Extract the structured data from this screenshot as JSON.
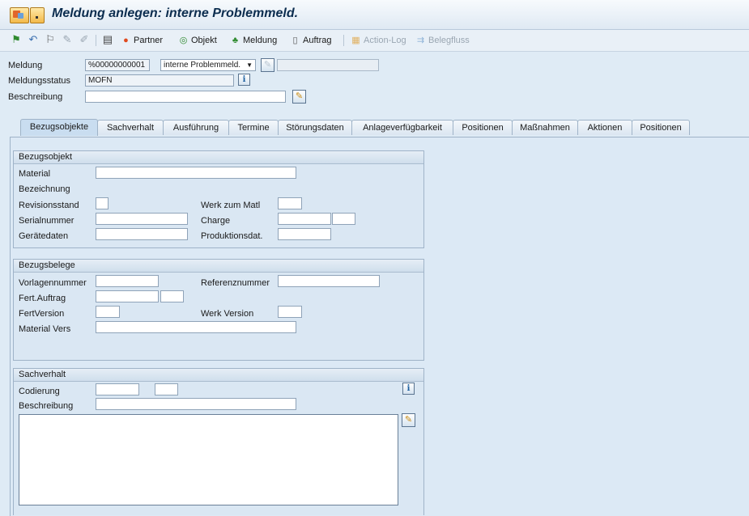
{
  "window": {
    "title": "Meldung anlegen: interne Problemmeld."
  },
  "toolbar": {
    "partner": "Partner",
    "objekt": "Objekt",
    "meldung": "Meldung",
    "auftrag": "Auftrag",
    "action_log": "Action-Log",
    "belegfluss": "Belegfluss"
  },
  "header": {
    "meldung_label": "Meldung",
    "meldung_value": "%00000000001",
    "meldungsart_value": "interne Problemmeld.",
    "meldung_text_value": "",
    "status_label": "Meldungsstatus",
    "status_value": "MOFN",
    "beschreibung_label": "Beschreibung",
    "beschreibung_value": ""
  },
  "tabs": [
    "Bezugsobjekte",
    "Sachverhalt",
    "Ausführung",
    "Termine",
    "Störungsdaten",
    "Anlageverfügbarkeit",
    "Positionen",
    "Maßnahmen",
    "Aktionen",
    "Positionen"
  ],
  "bezugsobjekt": {
    "title": "Bezugsobjekt",
    "material": "Material",
    "bezeichnung": "Bezeichnung",
    "revisionsstand": "Revisionsstand",
    "werk_zum_matl": "Werk zum Matl",
    "serialnummer": "Serialnummer",
    "charge": "Charge",
    "geraetedaten": "Gerätedaten",
    "produktionsdat": "Produktionsdat."
  },
  "bezugsbelege": {
    "title": "Bezugsbelege",
    "vorlagennummer": "Vorlagennummer",
    "referenznummer": "Referenznummer",
    "fert_auftrag": "Fert.Auftrag",
    "fert_version": "FertVersion",
    "werk_version": "Werk Version",
    "material_vers": "Material  Vers"
  },
  "sachverhalt": {
    "title": "Sachverhalt",
    "codierung": "Codierung",
    "beschreibung": "Beschreibung"
  },
  "colors": {
    "accent": "#0c2d4f",
    "background": "#dfebf5"
  }
}
